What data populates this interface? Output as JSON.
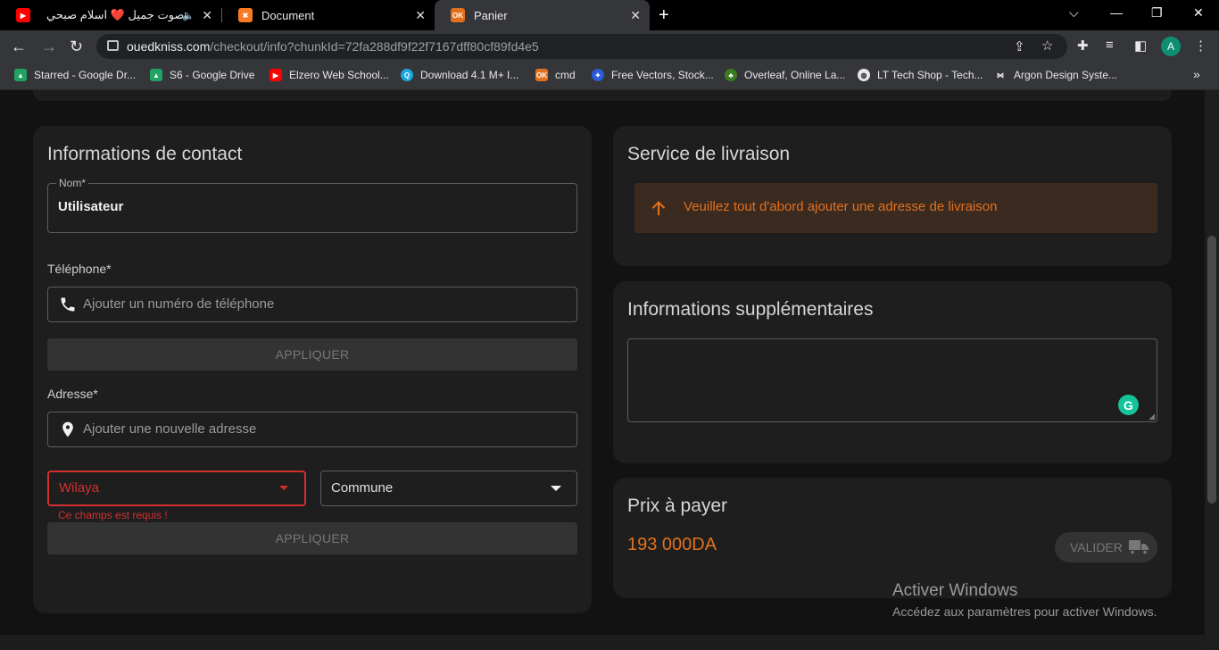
{
  "browser": {
    "tabs": [
      {
        "title": "صوت جميل ❤️ اسلام صبحي",
        "favicon": "youtube-icon"
      },
      {
        "title": "Document",
        "favicon": "xampp-icon"
      },
      {
        "title": "Panier",
        "favicon": "ouedkniss-icon"
      }
    ],
    "url_host": "ouedkniss.com",
    "url_path": "/checkout/info?chunkId=72fa288df9f22f7167dff80cf89fd4e5",
    "profile_initial": "A",
    "bookmarks": [
      "Starred - Google Dr...",
      "S6 - Google Drive",
      "Elzero Web School...",
      "Download 4.1 M+ I...",
      "cmd",
      "Free Vectors, Stock...",
      "Overleaf, Online La...",
      "LT Tech Shop - Tech...",
      "Argon Design Syste..."
    ]
  },
  "contact": {
    "title": "Informations de contact",
    "name_label": "Nom*",
    "name_value": "Utilisateur",
    "phone_label": "Téléphone*",
    "phone_placeholder": "Ajouter un numéro de téléphone",
    "apply_label": "APPLIQUER",
    "address_label": "Adresse*",
    "address_placeholder": "Ajouter une nouvelle adresse",
    "wilaya_label": "Wilaya",
    "wilaya_error": "Ce champs est requis !",
    "commune_label": "Commune",
    "apply2_label": "APPLIQUER"
  },
  "delivery": {
    "title": "Service de livraison",
    "alert_text": "Veuillez tout d'abord ajouter une adresse de livraison"
  },
  "extra": {
    "title": "Informations supplémentaires"
  },
  "price": {
    "title": "Prix à payer",
    "amount": "193 000DA",
    "validate_label": "VALIDER"
  },
  "watermark": {
    "line1": "Activer Windows",
    "line2": "Accédez aux paramètres pour activer Windows."
  },
  "colors": {
    "accent": "#e2711d",
    "error": "#d32f2f"
  }
}
